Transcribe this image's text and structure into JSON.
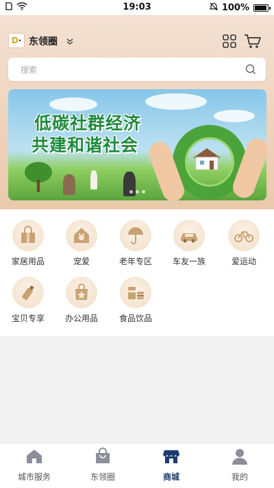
{
  "status_bar": {
    "time": "19:03",
    "battery": "100%",
    "battery_level": 1.0
  },
  "header": {
    "title": "东领圈",
    "icons": [
      "grid-icon",
      "cart-icon"
    ]
  },
  "search": {
    "placeholder": "搜索"
  },
  "banner": {
    "line1": "低碳社群经济",
    "line2": "共建和谐社会"
  },
  "categories": [
    {
      "label": "家居用品",
      "icon": "gift-bag-icon"
    },
    {
      "label": "宠爱",
      "icon": "pet-house-icon"
    },
    {
      "label": "老年专区",
      "icon": "umbrella-elder-icon"
    },
    {
      "label": "车友一族",
      "icon": "car-icon"
    },
    {
      "label": "爱运动",
      "icon": "bicycle-icon"
    },
    {
      "label": "宝贝专享",
      "icon": "baby-bottle-icon"
    },
    {
      "label": "办公用品",
      "icon": "shopping-bag-star-icon"
    },
    {
      "label": "食品饮品",
      "icon": "food-drink-icon"
    }
  ],
  "tabbar": [
    {
      "label": "城市服务",
      "icon": "home-icon",
      "active": false
    },
    {
      "label": "东领圈",
      "icon": "bag-icon",
      "active": false
    },
    {
      "label": "商城",
      "icon": "store-icon",
      "active": true
    },
    {
      "label": "我的",
      "icon": "user-icon",
      "active": false
    }
  ],
  "colors": {
    "accent": "#1f3c6e",
    "icon_gold": "#c9a273",
    "hero_bg": "#eac9ac"
  }
}
